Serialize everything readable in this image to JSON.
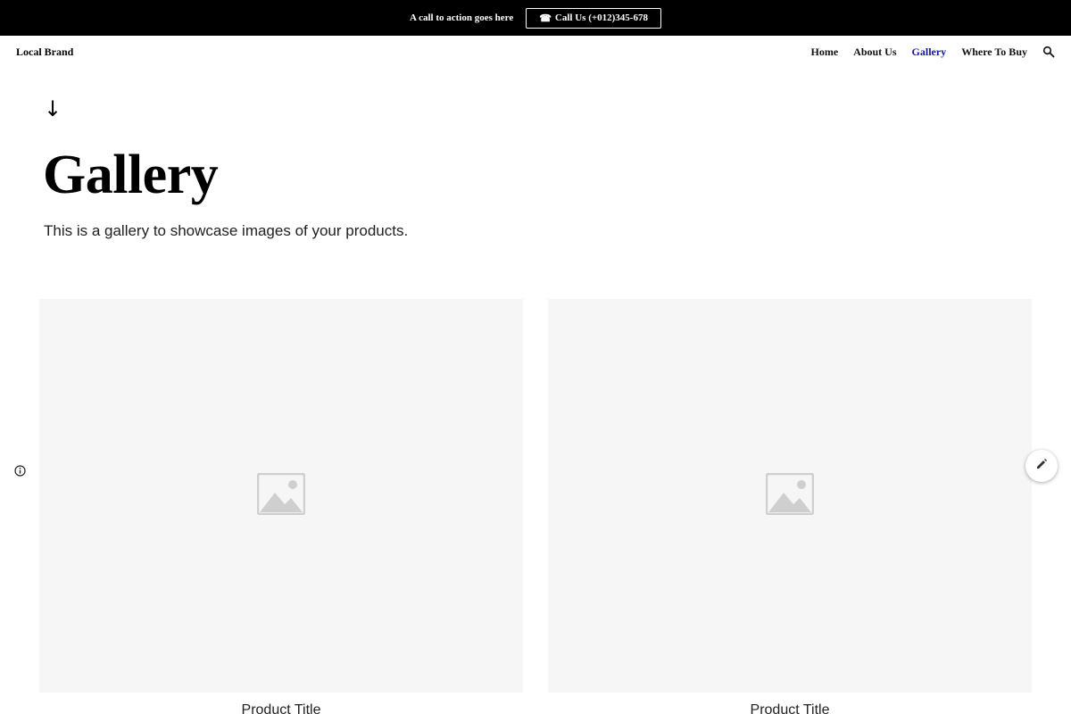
{
  "announcement": {
    "text": "A call to action goes here",
    "button_icon": "☎",
    "button_label": "Call Us (+012)345-678"
  },
  "header": {
    "brand": "Local Brand",
    "nav": [
      {
        "label": "Home",
        "active": false
      },
      {
        "label": "About Us",
        "active": false
      },
      {
        "label": "Gallery",
        "active": true
      },
      {
        "label": "Where To Buy",
        "active": false
      }
    ],
    "search_icon": "search-icon"
  },
  "hero": {
    "arrow": "↓",
    "title": "Gallery",
    "subtitle": "This is a gallery to showcase images of your products."
  },
  "gallery": {
    "items": [
      {
        "caption": "Product Title",
        "image_icon": "image-placeholder-icon"
      },
      {
        "caption": "Product Title",
        "image_icon": "image-placeholder-icon"
      }
    ]
  },
  "colors": {
    "topbar": "#000000",
    "active_nav": "#1414a8",
    "placeholder_bg": "#f6f6f6",
    "placeholder_icon": "#cfcfcf"
  },
  "icons": {
    "info": "info-icon",
    "edit": "pencil-icon"
  }
}
